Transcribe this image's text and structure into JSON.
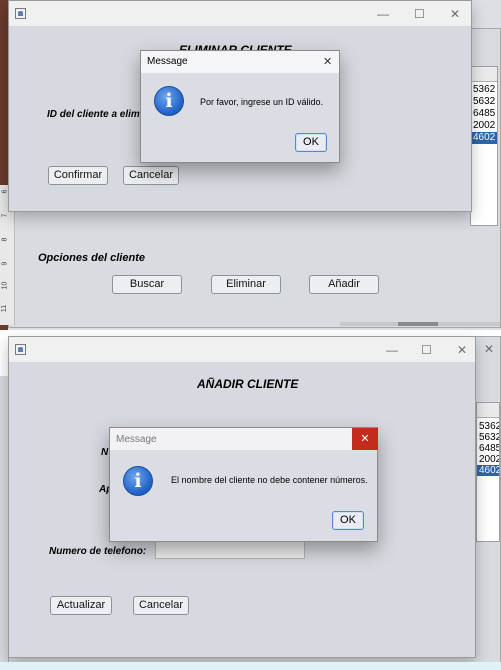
{
  "top": {
    "panel_title": "ELIMINAR CLIENTE",
    "id_label": "ID del cliente a elimin",
    "confirm_btn": "Confirmar",
    "cancel_btn": "Cancelar",
    "list_items": [
      "5362",
      "5632",
      "6485",
      "2002",
      "4602"
    ],
    "options_label": "Opciones del cliente",
    "search_btn": "Buscar",
    "delete_btn": "Eliminar",
    "add_btn": "Añadir",
    "ruler": [
      "6",
      "7",
      "8",
      "9",
      "10",
      "11"
    ],
    "dialog": {
      "title": "Message",
      "message": "Por favor, ingrese un ID válido.",
      "ok": "OK",
      "close": "✕"
    },
    "win_controls": {
      "min": "—",
      "max": "☐",
      "close": "✕"
    }
  },
  "bottom": {
    "panel_title": "AÑADIR CLIENTE",
    "name_label": "N",
    "surname_label": "Ap",
    "phone_label": "Numero de telefono:",
    "update_btn": "Actualizar",
    "cancel_btn": "Cancelar",
    "list_items": [
      "5362",
      "5632",
      "6485",
      "2002",
      "4602"
    ],
    "dialog": {
      "title": "Message",
      "message": "El nombre del cliente no debe contener números.",
      "ok": "OK",
      "close": "✕"
    },
    "win_controls": {
      "min": "—",
      "max": "☐",
      "close": "✕",
      "outer_close": "✕"
    }
  },
  "colors": {
    "selection": "#2f65a8",
    "close_red": "#c42b1c",
    "info_blue": "#1d5fc4"
  }
}
